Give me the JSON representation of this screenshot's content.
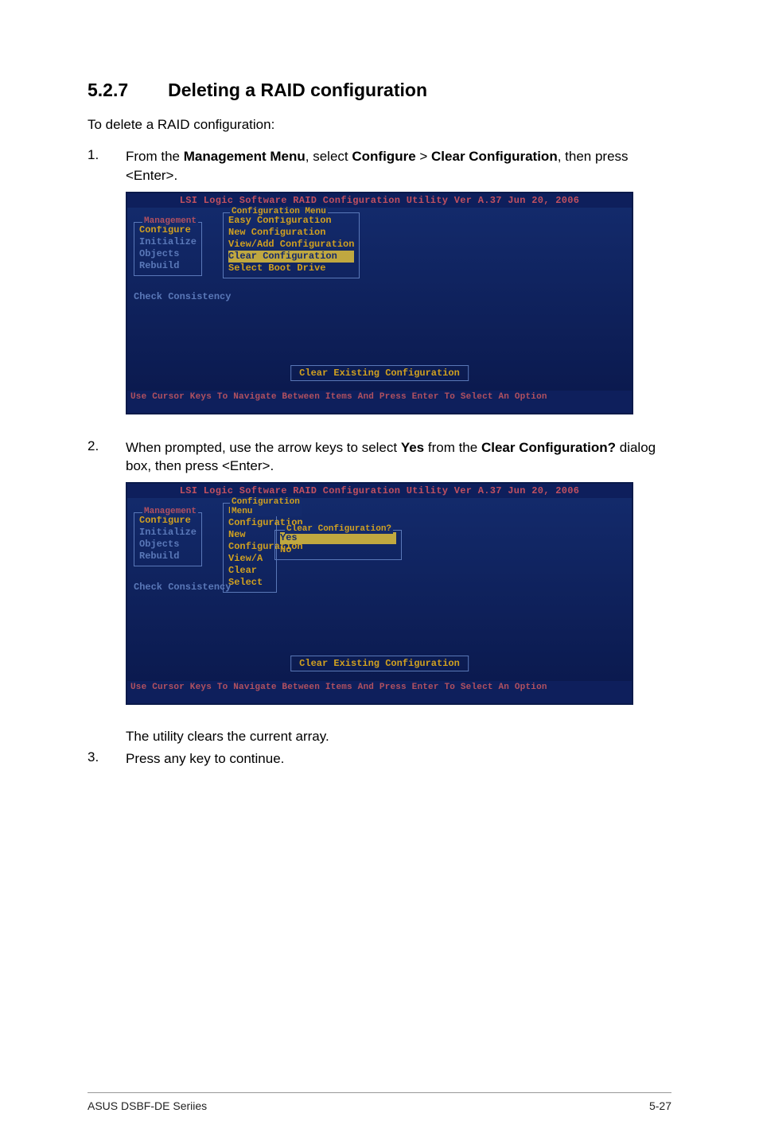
{
  "heading": {
    "number": "5.2.7",
    "title": "Deleting a RAID configuration"
  },
  "intro": "To delete a RAID configuration:",
  "step1": {
    "num": "1.",
    "pre": "From the ",
    "menu": "Management Menu",
    "mid1": ", select ",
    "cfg": "Configure",
    "gt": " > ",
    "clear": "Clear Configuration",
    "post": ", then press <Enter>."
  },
  "bios1": {
    "title": "LSI Logic Software RAID Configuration Utility Ver A.37 Jun 20, 2006",
    "mgmt_label": "Management",
    "mgmt_items": [
      "Configure",
      "Initialize",
      "Objects",
      "Rebuild"
    ],
    "check": "Check Consistency",
    "cfg_label": "Configuration Menu",
    "cfg_items": {
      "i1": "Easy Configuration",
      "i2": "New Configuration",
      "i3": "View/Add Configuration",
      "i4": "Clear Configuration",
      "i5": "Select Boot Drive"
    },
    "desc": "Clear Existing Configuration",
    "footer": "Use Cursor Keys To Navigate Between Items And Press Enter To Select An Option"
  },
  "step2": {
    "num": "2.",
    "pre": "When prompted, use the arrow keys to select ",
    "yes": "Yes",
    "mid1": " from the ",
    "dlg": "Clear Configuration?",
    "post": " dialog box, then press <Enter>."
  },
  "bios2": {
    "title": "LSI Logic Software RAID Configuration Utility Ver A.37 Jun 20, 2006",
    "mgmt_label": "Management",
    "mgmt_items": [
      "Configure",
      "Initialize",
      "Objects",
      "Rebuild"
    ],
    "check": "Check Consistency",
    "cfg_label": "Configuration Menu",
    "cfg_partial": {
      "i1": "Easy Configuration",
      "i2": "New Configuration",
      "i3": "View/A",
      "i4": "Clear",
      "i5": "Select"
    },
    "dlg_label": "Clear Configuration?",
    "dlg_items": {
      "yes": "Yes",
      "no": "No"
    },
    "desc": "Clear Existing Configuration",
    "footer": "Use Cursor Keys To Navigate Between Items And Press Enter To Select An Option"
  },
  "post_step2": "The utility clears the current array.",
  "step3": {
    "num": "3.",
    "text": "Press any key to continue."
  },
  "footer": {
    "left": "ASUS DSBF-DE Seriies",
    "right": "5-27"
  }
}
